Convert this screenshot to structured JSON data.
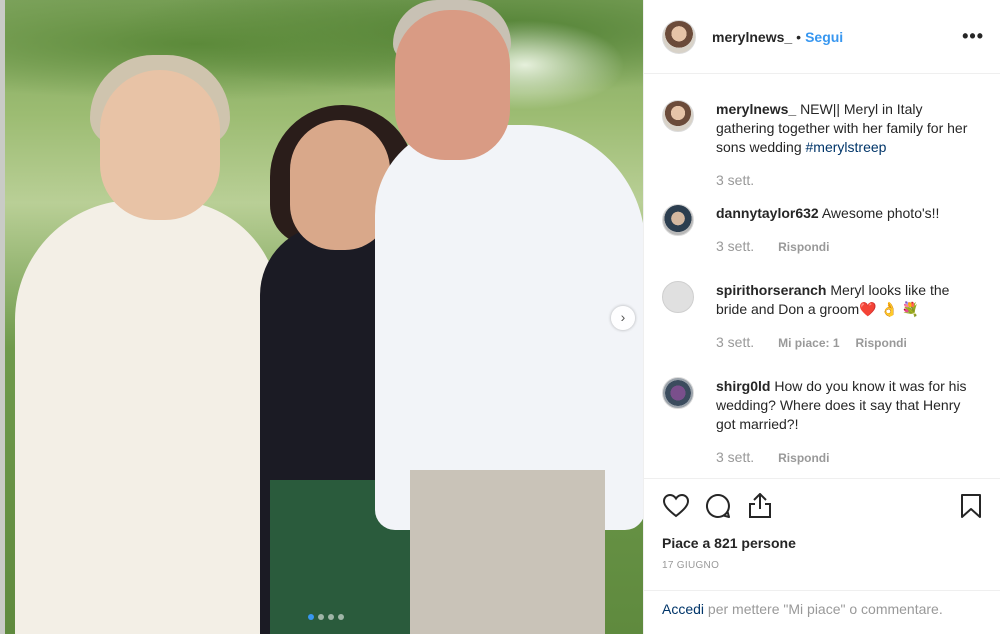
{
  "header": {
    "username": "merylnews_",
    "separator": "•",
    "follow_label": "Segui",
    "more_label": "•••"
  },
  "caption": {
    "username": "merylnews_",
    "text": "NEW|| Meryl in Italy gathering together with her family for her sons wedding",
    "hashtag": "#merylstreep",
    "time": "3 sett."
  },
  "comments": [
    {
      "username": "dannytaylor632",
      "text": "Awesome photo's!!",
      "time": "3 sett.",
      "likes": "",
      "reply": "Rispondi"
    },
    {
      "username": "spirithorseranch",
      "text": "Meryl looks like the bride and Don a groom❤️ 👌 💐",
      "time": "3 sett.",
      "likes": "Mi piace: 1",
      "reply": "Rispondi"
    },
    {
      "username": "shirg0ld",
      "text": "How do you know it was for his wedding? Where does it say that Henry got married?!",
      "time": "3 sett.",
      "likes": "",
      "reply": "Rispondi"
    }
  ],
  "actions": {
    "like_icon": "heart-icon",
    "comment_icon": "comment-icon",
    "share_icon": "share-icon",
    "save_icon": "bookmark-icon",
    "likes_text": "Piace a 821 persone",
    "date": "17 GIUGNO"
  },
  "login": {
    "link": "Accedi",
    "text": " per mettere \"Mi piace\" o commentare."
  },
  "carousel": {
    "next_label": "›",
    "total_slides": 4,
    "active_slide": 1
  },
  "colors": {
    "link_blue": "#3897f0",
    "hashtag_blue": "#003569",
    "muted": "#999999"
  }
}
